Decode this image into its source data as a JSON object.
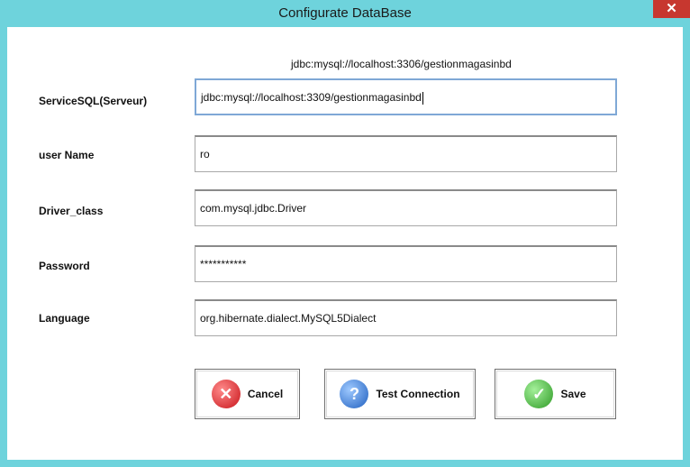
{
  "window": {
    "title": "Configurate DataBase",
    "close_label": "✕"
  },
  "hint": "jdbc:mysql://localhost:3306/gestionmagasinbd",
  "fields": {
    "servicesql": {
      "label": "ServiceSQL(Serveur)",
      "value": "jdbc:mysql://localhost:3309/gestionmagasinbd"
    },
    "username": {
      "label": "user Name",
      "value": "ro"
    },
    "driver": {
      "label": "Driver_class",
      "value": "com.mysql.jdbc.Driver"
    },
    "password": {
      "label": "Password",
      "value": "***********"
    },
    "language": {
      "label": "Language",
      "value": "org.hibernate.dialect.MySQL5Dialect"
    }
  },
  "buttons": {
    "cancel": {
      "label": "Cancel",
      "icon": "cancel-x-icon",
      "color": "#c8141a"
    },
    "test": {
      "label": "Test Connection",
      "icon": "question-icon",
      "color": "#1f5fbf"
    },
    "save": {
      "label": "Save",
      "icon": "check-icon",
      "color": "#2e9a25"
    }
  },
  "colors": {
    "frame": "#6ed3dc",
    "close_button": "#c7372f",
    "active_border": "#7fa8d6"
  }
}
